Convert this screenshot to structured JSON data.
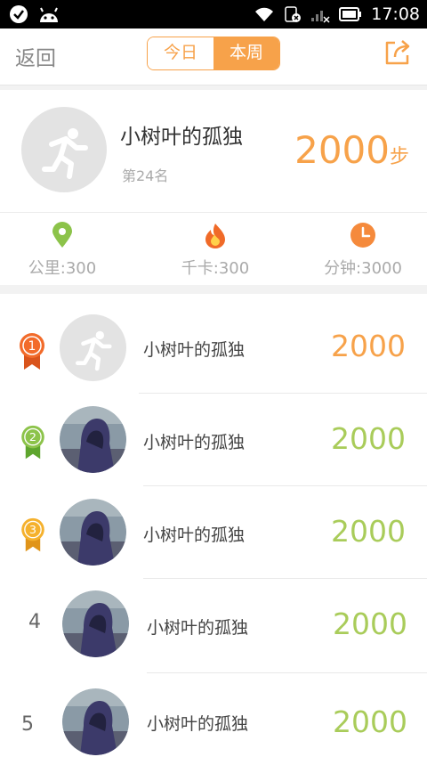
{
  "status_bar": {
    "time": "17:08"
  },
  "header": {
    "back_label": "返回",
    "tabs": [
      {
        "label": "今日",
        "selected": false
      },
      {
        "label": "本周",
        "selected": true
      }
    ],
    "accent_color": "#f7a24a"
  },
  "profile": {
    "name": "小树叶的孤独",
    "rank_text": "第24名",
    "steps": "2000",
    "steps_unit": "步"
  },
  "stats": [
    {
      "icon": "location-pin-icon",
      "text": "公里:300",
      "color": "#8cc34a"
    },
    {
      "icon": "fire-icon",
      "text": "千卡:300",
      "color": "#f06a28"
    },
    {
      "icon": "clock-icon",
      "text": "分钟:3000",
      "color": "#f58a3c"
    }
  ],
  "ranking": [
    {
      "rank": "1",
      "name": "小树叶的孤独",
      "value": "2000",
      "avatar": "runner",
      "medal_color": "#f26b2a",
      "value_color": "#f7a24a"
    },
    {
      "rank": "2",
      "name": "小树叶的孤独",
      "value": "2000",
      "avatar": "photo",
      "medal_color": "#8cc34a",
      "value_color": "#a9cc5a"
    },
    {
      "rank": "3",
      "name": "小树叶的孤独",
      "value": "2000",
      "avatar": "photo",
      "medal_color": "#f5b12d",
      "value_color": "#a9cc5a"
    },
    {
      "rank": "4",
      "name": "小树叶的孤独",
      "value": "2000",
      "avatar": "photo",
      "medal_color": "",
      "value_color": "#a9cc5a"
    },
    {
      "rank": "5",
      "name": "小树叶的孤独",
      "value": "2000",
      "avatar": "photo",
      "medal_color": "",
      "value_color": "#a9cc5a"
    }
  ]
}
